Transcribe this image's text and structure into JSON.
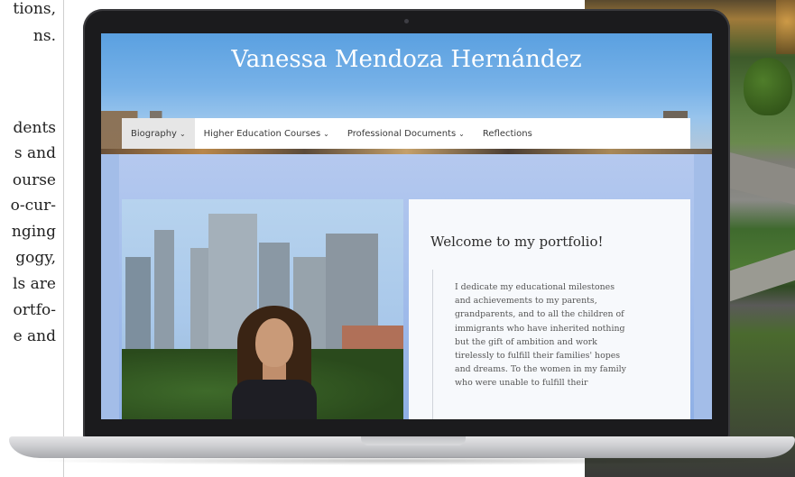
{
  "left_article": {
    "lines": [
      "tions,",
      "ns.",
      "dents",
      "s and",
      "ourse",
      "o-cur-",
      "nging",
      "gogy,",
      "ls are",
      "ortfo-",
      "e and"
    ]
  },
  "site": {
    "title": "Vanessa Mendoza Hernández",
    "nav": [
      {
        "label": "Biography",
        "has_menu": true,
        "active": true
      },
      {
        "label": "Higher Education Courses",
        "has_menu": true,
        "active": false
      },
      {
        "label": "Professional Documents",
        "has_menu": true,
        "active": false
      },
      {
        "label": "Reflections",
        "has_menu": false,
        "active": false
      }
    ],
    "chevron_glyph": "⌄",
    "welcome_title": "Welcome to my portfolio!",
    "dedication_lines": [
      "I dedicate my educational milestones",
      "and achievements to my parents,",
      "grandparents, and to all the children of",
      "immigrants who have inherited nothing",
      "but the gift of ambition and work",
      "tirelessly to fulfill their families' hopes",
      "and dreams. To the women in my family",
      "who were unable to fulfill their"
    ]
  },
  "colors": {
    "accent_sky": "#78b2e8",
    "page_bg": "#a3bde8",
    "laptop_bezel": "#1b1b1d"
  }
}
